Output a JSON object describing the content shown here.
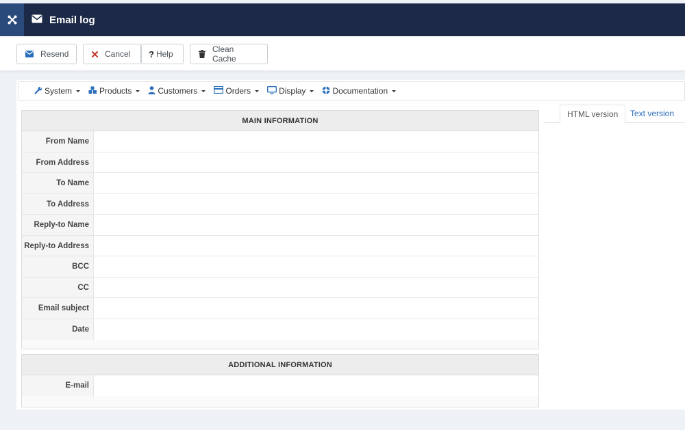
{
  "header": {
    "title": "Email log",
    "logo_icon": "joomla-logo-icon",
    "title_icon": "envelope-icon"
  },
  "toolbar": {
    "resend_label": "Resend",
    "cancel_label": "Cancel",
    "help_label": "Help",
    "clean_cache_label": "Clean Cache"
  },
  "menu": {
    "items": [
      {
        "label": "System",
        "icon": "wrench-icon"
      },
      {
        "label": "Products",
        "icon": "cubes-icon"
      },
      {
        "label": "Customers",
        "icon": "user-icon"
      },
      {
        "label": "Orders",
        "icon": "credit-card-icon"
      },
      {
        "label": "Display",
        "icon": "monitor-icon"
      },
      {
        "label": "Documentation",
        "icon": "lifebuoy-icon"
      }
    ]
  },
  "main_info": {
    "heading": "MAIN INFORMATION",
    "fields": [
      {
        "label": "From Name",
        "value": ""
      },
      {
        "label": "From Address",
        "value": ""
      },
      {
        "label": "To Name",
        "value": ""
      },
      {
        "label": "To Address",
        "value": ""
      },
      {
        "label": "Reply-to Name",
        "value": ""
      },
      {
        "label": "Reply-to Address",
        "value": ""
      },
      {
        "label": "BCC",
        "value": ""
      },
      {
        "label": "CC",
        "value": ""
      },
      {
        "label": "Email subject",
        "value": ""
      },
      {
        "label": "Date",
        "value": ""
      }
    ]
  },
  "additional_info": {
    "heading": "ADDITIONAL INFORMATION",
    "fields": [
      {
        "label": "E-mail",
        "value": ""
      }
    ]
  },
  "tabs": {
    "html_label": "HTML version",
    "text_label": "Text version",
    "active": "HTML version"
  },
  "colors": {
    "header_bg": "#1c2a48",
    "logo_bg": "#2b4a7c",
    "link": "#2a6ebb",
    "cancel_red": "#c0392b"
  }
}
